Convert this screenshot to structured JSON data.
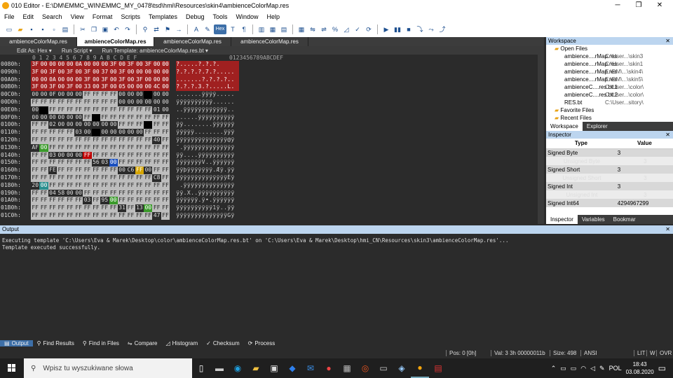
{
  "window": {
    "title": "010 Editor - E:\\DM\\EMMC_WIN\\EMMC_MY_0478\\tsd\\hmi\\Resources\\skin4\\ambienceColorMap.res",
    "minimize": "─",
    "maximize": "❐",
    "close": "✕"
  },
  "menu": [
    "File",
    "Edit",
    "Search",
    "View",
    "Format",
    "Scripts",
    "Templates",
    "Debug",
    "Tools",
    "Window",
    "Help"
  ],
  "tabs": [
    "ambienceColorMap.res",
    "ambienceColorMap.res",
    "ambienceColorMap.res",
    "ambienceColorMap.res"
  ],
  "editor_header": {
    "edit_as": "Edit As: Hex ▾",
    "run_script": "Run Script ▾",
    "run_template": "Run Template: ambienceColorMap.res.bt ▾"
  },
  "hex": {
    "col_header": "0  1  2  3  4  5  6  7  8  9  A  B  C  D  E  F",
    "ascii_header": "0123456789ABCDEF",
    "rows": [
      {
        "addr": "0080h:",
        "bytes": [
          "3F",
          "00",
          "00",
          "00",
          "00",
          "0A",
          "00",
          "00",
          "00",
          "3F",
          "00",
          "3F",
          "00",
          "3F",
          "00",
          "00"
        ],
        "ascii": "?.....?.?.?.",
        "hi": true
      },
      {
        "addr": "0090h:",
        "bytes": [
          "3F",
          "00",
          "3F",
          "00",
          "3F",
          "00",
          "3F",
          "00",
          "37",
          "00",
          "3F",
          "00",
          "00",
          "00",
          "00",
          "00"
        ],
        "ascii": "?.?.?.?.7.?.....",
        "hi": true
      },
      {
        "addr": "00A0h:",
        "bytes": [
          "00",
          "00",
          "0A",
          "00",
          "00",
          "00",
          "3F",
          "00",
          "3F",
          "00",
          "3F",
          "00",
          "3F",
          "00",
          "00",
          "00"
        ],
        "ascii": ".......?.?.?.?..",
        "hi": true
      },
      {
        "addr": "00B0h:",
        "bytes": [
          "3F",
          "00",
          "3F",
          "00",
          "3F",
          "00",
          "33",
          "00",
          "3F",
          "00",
          "05",
          "00",
          "00",
          "00",
          "4C",
          "00"
        ],
        "ascii": "?.?.?.3.?.....L.",
        "hi": true
      },
      {
        "addr": "00C0h:",
        "bytes": [
          "00",
          "00",
          "0F",
          "00",
          "00",
          "00",
          "FF",
          "FF",
          "FF",
          "FF",
          "00",
          "00",
          "00",
          "00",
          "00",
          "00"
        ],
        "ascii": ".......ÿÿÿÿ.....",
        "hi": false
      },
      {
        "addr": "00D0h:",
        "bytes": [
          "FF",
          "FF",
          "FF",
          "FF",
          "FF",
          "FF",
          "FF",
          "FF",
          "FF",
          "FF",
          "00",
          "00",
          "00",
          "00",
          "00",
          "00"
        ],
        "ascii": "ÿÿÿÿÿÿÿÿÿÿ......",
        "hi": false
      },
      {
        "addr": "00E0h:",
        "bytes": [
          "00",
          "00",
          "FF",
          "FF",
          "FF",
          "FF",
          "FF",
          "FF",
          "FF",
          "FF",
          "FF",
          "FF",
          "FF",
          "FF",
          "01",
          "00"
        ],
        "ascii": "..ÿÿÿÿÿÿÿÿÿÿÿÿ..",
        "hi": false
      },
      {
        "addr": "00F0h:",
        "bytes": [
          "00",
          "00",
          "00",
          "00",
          "00",
          "00",
          "FF",
          "FF",
          "FF",
          "FF",
          "FF",
          "FF",
          "FF",
          "FF",
          "FF",
          "FF"
        ],
        "ascii": "......ÿÿÿÿÿÿÿÿÿÿ",
        "hi": false
      },
      {
        "addr": "0100h:",
        "bytes": [
          "FF",
          "FF",
          "02",
          "00",
          "00",
          "00",
          "00",
          "00",
          "00",
          "00",
          "FF",
          "FF",
          "FF",
          "FF",
          "FF",
          "FF"
        ],
        "ascii": "ÿÿ........ÿÿÿÿÿÿ",
        "hi": false
      },
      {
        "addr": "0110h:",
        "bytes": [
          "FF",
          "FF",
          "FF",
          "FF",
          "FF",
          "03",
          "00",
          "00",
          "00",
          "00",
          "00",
          "00",
          "00",
          "FF",
          "FF",
          "FF"
        ],
        "ascii": "ÿÿÿÿÿ........ÿÿÿ",
        "hi": false
      },
      {
        "addr": "0120h:",
        "bytes": [
          "FF",
          "FF",
          "FF",
          "FF",
          "FF",
          "FF",
          "FF",
          "FF",
          "FF",
          "FF",
          "FF",
          "FF",
          "FF",
          "FF",
          "40",
          "FF"
        ],
        "ascii": "ÿÿÿÿÿÿÿÿÿÿÿÿÿÿ@ÿ",
        "hi": false
      },
      {
        "addr": "0130h:",
        "bytes": [
          "AF",
          "00",
          "FF",
          "FF",
          "FF",
          "FF",
          "FF",
          "FF",
          "FF",
          "FF",
          "FF",
          "FF",
          "FF",
          "FF",
          "FF",
          "FF"
        ],
        "ascii": "¯.ÿÿÿÿÿÿÿÿÿÿÿÿÿÿ",
        "hi": false
      },
      {
        "addr": "0140h:",
        "bytes": [
          "FF",
          "FF",
          "03",
          "00",
          "00",
          "00",
          "FF",
          "FF",
          "FF",
          "FF",
          "FF",
          "FF",
          "FF",
          "FF",
          "FF",
          "FF"
        ],
        "ascii": "ÿÿ....ÿÿÿÿÿÿÿÿÿÿ",
        "hi": false
      },
      {
        "addr": "0150h:",
        "bytes": [
          "FF",
          "FF",
          "FF",
          "FF",
          "FF",
          "FF",
          "FF",
          "56",
          "03",
          "00",
          "FF",
          "FF",
          "FF",
          "FF",
          "FF",
          "FF"
        ],
        "ascii": "ÿÿÿÿÿÿÿV..ÿÿÿÿÿÿ",
        "hi": false
      },
      {
        "addr": "0160h:",
        "bytes": [
          "FF",
          "FF",
          "FE",
          "FF",
          "FF",
          "FF",
          "FF",
          "FF",
          "FF",
          "FF",
          "00",
          "C6",
          "FF",
          "00",
          "FF",
          "FF"
        ],
        "ascii": "ÿÿþÿÿÿÿÿÿÿ.Æÿ.ÿÿ",
        "hi": false
      },
      {
        "addr": "0170h:",
        "bytes": [
          "FF",
          "FF",
          "FF",
          "FF",
          "FF",
          "FF",
          "FF",
          "FF",
          "FF",
          "FF",
          "FF",
          "FF",
          "FF",
          "FF",
          "C8",
          "FF"
        ],
        "ascii": "ÿÿÿÿÿÿÿÿÿÿÿÿÿÿÈÿ",
        "hi": false
      },
      {
        "addr": "0180h:",
        "bytes": [
          "20",
          "00",
          "FF",
          "FF",
          "FF",
          "FF",
          "FF",
          "FF",
          "FF",
          "FF",
          "FF",
          "FF",
          "FF",
          "FF",
          "FF",
          "FF"
        ],
        "ascii": " .ÿÿÿÿÿÿÿÿÿÿÿÿÿÿ",
        "hi": false
      },
      {
        "addr": "0190h:",
        "bytes": [
          "FF",
          "FF",
          "04",
          "58",
          "00",
          "00",
          "FF",
          "FF",
          "FF",
          "FF",
          "FF",
          "FF",
          "FF",
          "FF",
          "FF",
          "FF"
        ],
        "ascii": "ÿÿ.X..ÿÿÿÿÿÿÿÿÿÿ",
        "hi": false
      },
      {
        "addr": "01A0h:",
        "bytes": [
          "FF",
          "FF",
          "FF",
          "FF",
          "FF",
          "FF",
          "03",
          "FF",
          "95",
          "00",
          "FF",
          "FF",
          "FF",
          "FF",
          "FF",
          "FF"
        ],
        "ascii": "ÿÿÿÿÿÿ.ÿ•.ÿÿÿÿÿÿ",
        "hi": false
      },
      {
        "addr": "01B0h:",
        "bytes": [
          "FF",
          "FF",
          "FF",
          "FF",
          "FF",
          "FF",
          "FF",
          "FF",
          "FF",
          "FF",
          "31",
          "FF",
          "13",
          "00",
          "FF",
          "FF"
        ],
        "ascii": "ÿÿÿÿÿÿÿÿÿÿ1ÿ..ÿÿ",
        "hi": false
      },
      {
        "addr": "01C0h:",
        "bytes": [
          "FF",
          "FF",
          "FF",
          "FF",
          "FF",
          "FF",
          "FF",
          "FF",
          "FF",
          "FF",
          "FF",
          "FF",
          "FF",
          "FF",
          "47",
          "FF"
        ],
        "ascii": "ÿÿÿÿÿÿÿÿÿÿÿÿÿÿGÿ",
        "hi": false
      }
    ]
  },
  "workspace": {
    "title": "Workspace",
    "open_files_label": "Open Files",
    "files": [
      {
        "name": "ambience....rMap.res",
        "path": "C:\\User...\\skin3"
      },
      {
        "name": "ambience....rMap.res",
        "path": "C:\\User...\\skin1"
      },
      {
        "name": "ambience....rMap.res",
        "path": "E:\\DM\\...\\skin4\\"
      },
      {
        "name": "ambience....rMap.res",
        "path": "E:\\DM\\...\\skin5\\"
      },
      {
        "name": "ambienceC....res.bt:1",
        "path": "C:\\User...\\color\\"
      },
      {
        "name": "ambienceC....res.bt:2",
        "path": "C:\\User...\\color\\"
      },
      {
        "name": "RES.bt",
        "path": "C:\\User...sitory\\"
      }
    ],
    "favorite_files": "Favorite Files",
    "recent_files": "Recent Files",
    "tab_workspace": "Workspace",
    "tab_explorer": "Explorer"
  },
  "inspector": {
    "title": "Inspector",
    "col_type": "Type",
    "col_value": "Value",
    "rows": [
      {
        "type": "Signed Byte",
        "value": "3"
      },
      {
        "type": "Unsigned Byte",
        "value": "3"
      },
      {
        "type": "Signed Short",
        "value": "3"
      },
      {
        "type": "Unsigned Short",
        "value": "3"
      },
      {
        "type": "Signed Int",
        "value": "3"
      },
      {
        "type": "Unsigned Int",
        "value": "3"
      },
      {
        "type": "Signed Int64",
        "value": "4294967299"
      }
    ],
    "tab_inspector": "Inspector",
    "tab_variables": "Variables",
    "tab_bookmarks": "Bookmar"
  },
  "output": {
    "title": "Output",
    "line1": "Executing template 'C:\\Users\\Eva & Marek\\Desktop\\color\\ambienceColorMap.res.bt' on 'C:\\Users\\Eva & Marek\\Desktop\\hmi_CN\\Resources\\skin3\\ambienceColorMap.res'...",
    "line2": "Template executed successfully."
  },
  "bottom_tabs": [
    "Output",
    "Find Results",
    "Find in Files",
    "Compare",
    "Histogram",
    "Checksum",
    "Process"
  ],
  "status": {
    "pos": "Pos: 0 [0h]",
    "val": "Val: 3 3h 00000011b",
    "size": "Size: 498",
    "enc": "ANSI",
    "lit": "LIT",
    "w": "W",
    "ovr": "OVR"
  },
  "taskbar": {
    "search_placeholder": "Wpisz tu wyszukiwane słowa",
    "lang": "POL",
    "time": "18:43",
    "date": "03.08.2020"
  },
  "colors": {
    "accent": "#3d6fa8",
    "template_highlight": "#a02020",
    "panel_header": "#bcd5ef"
  }
}
